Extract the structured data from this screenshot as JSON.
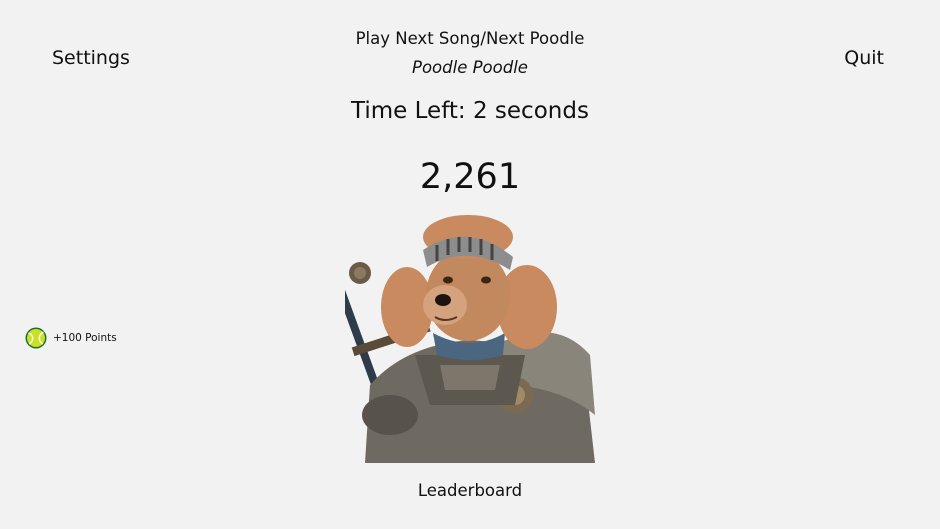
{
  "header": {
    "settings_label": "Settings",
    "quit_label": "Quit",
    "play_next_label": "Play Next Song/Next Poodle",
    "song_name": "Poodle Poodle"
  },
  "timer": {
    "text": "Time Left: 2 seconds"
  },
  "score": {
    "value": "2,261"
  },
  "bonus": {
    "text": "+100 Points",
    "icon": "tennis-ball-icon"
  },
  "image": {
    "subject": "knight-poodle"
  },
  "footer": {
    "leaderboard_label": "Leaderboard"
  }
}
